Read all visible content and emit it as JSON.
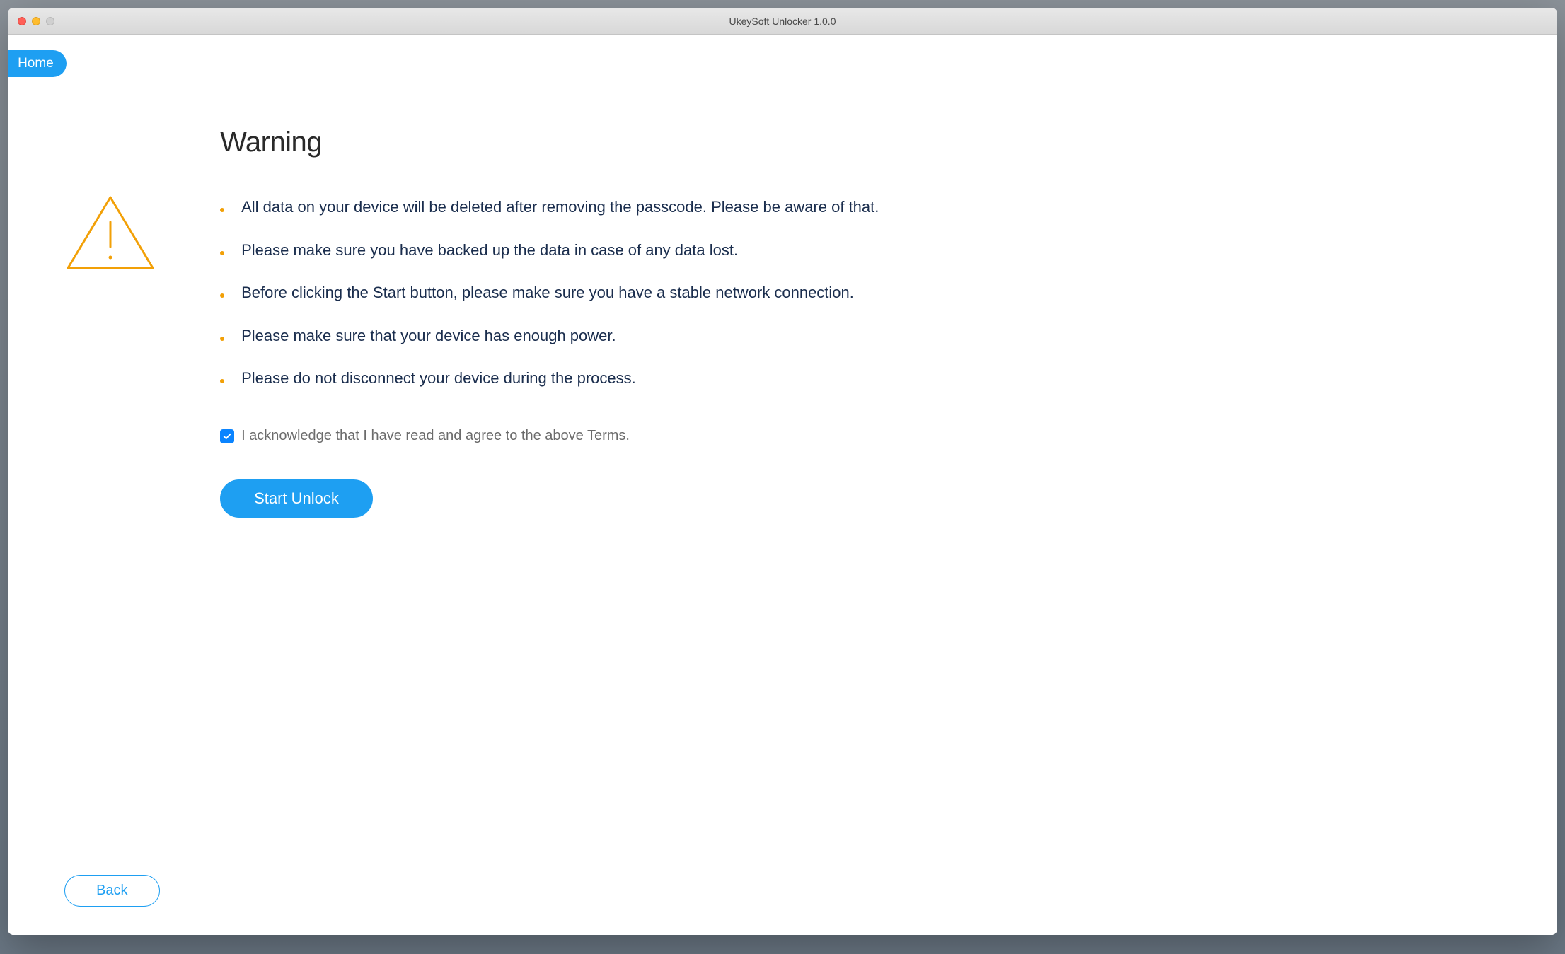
{
  "titlebar": {
    "title": "UkeySoft Unlocker 1.0.0"
  },
  "nav": {
    "home_label": "Home"
  },
  "main": {
    "heading": "Warning",
    "bullets": [
      "All data on your device will be deleted after removing the passcode. Please be aware of that.",
      "Please make sure you have backed up the data in case of any data lost.",
      "Before clicking the Start button, please make sure you have a stable network connection.",
      "Please make sure that your device has enough power.",
      "Please do not disconnect your device during the process."
    ],
    "ack_label": "I acknowledge that I have read and agree to the above Terms.",
    "ack_checked": true,
    "start_label": "Start Unlock",
    "back_label": "Back"
  }
}
